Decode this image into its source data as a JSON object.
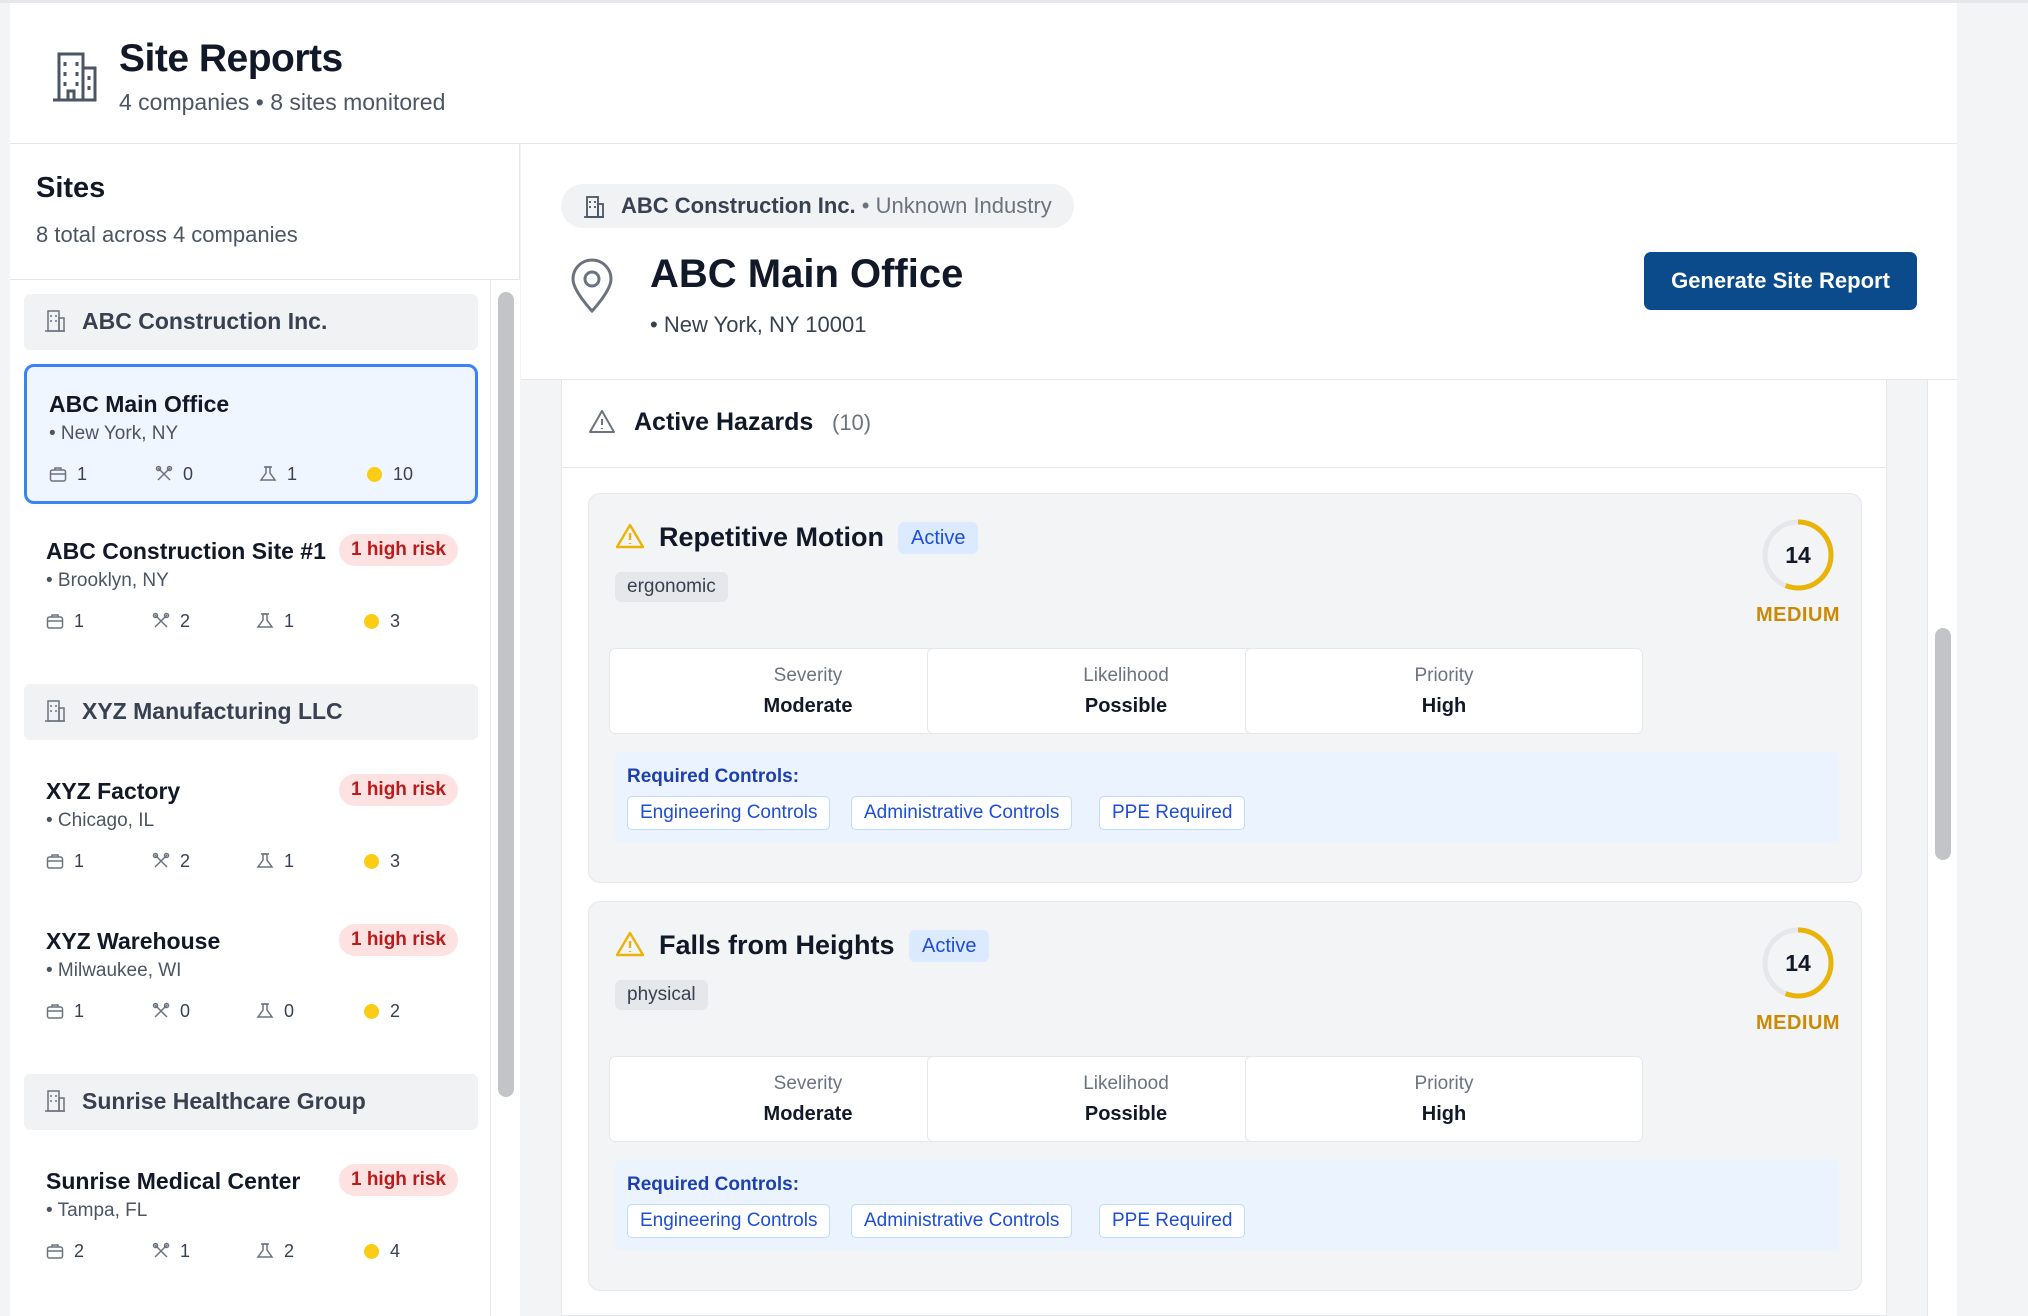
{
  "header": {
    "title": "Site Reports",
    "subtitle": "4 companies • 8 sites monitored",
    "icon": "building-icon"
  },
  "sidebar": {
    "title": "Sites",
    "subtitle": "8 total across 4 companies",
    "groups": [
      {
        "name": "ABC Construction Inc.",
        "sites": [
          {
            "name": "ABC Main Office",
            "location": "• New York, NY",
            "risk": "",
            "stats": {
              "a": "1",
              "b": "0",
              "c": "1",
              "d": "10"
            },
            "selected": true
          },
          {
            "name": "ABC Construction Site #1",
            "location": "• Brooklyn, NY",
            "risk": "1 high risk",
            "stats": {
              "a": "1",
              "b": "2",
              "c": "1",
              "d": "3"
            }
          }
        ]
      },
      {
        "name": "XYZ Manufacturing LLC",
        "sites": [
          {
            "name": "XYZ Factory",
            "location": "• Chicago, IL",
            "risk": "1 high risk",
            "stats": {
              "a": "1",
              "b": "2",
              "c": "1",
              "d": "3"
            }
          },
          {
            "name": "XYZ Warehouse",
            "location": "• Milwaukee, WI",
            "risk": "1 high risk",
            "stats": {
              "a": "1",
              "b": "0",
              "c": "0",
              "d": "2"
            }
          }
        ]
      },
      {
        "name": "Sunrise Healthcare Group",
        "sites": [
          {
            "name": "Sunrise Medical Center",
            "location": "• Tampa, FL",
            "risk": "1 high risk",
            "stats": {
              "a": "2",
              "b": "1",
              "c": "2",
              "d": "4"
            }
          }
        ]
      }
    ]
  },
  "main": {
    "company": "ABC Construction Inc.",
    "industry": "• Unknown Industry",
    "site_title": "ABC Main Office",
    "site_address": "• New York, NY 10001",
    "generate_button": "Generate Site Report",
    "hazards_title": "Active Hazards",
    "hazards_count": "(10)",
    "hazards": [
      {
        "title": "Repetitive Motion",
        "status": "Active",
        "category": "ergonomic",
        "score": "14",
        "score_fraction": 0.56,
        "level": "MEDIUM",
        "metrics": [
          {
            "label": "Severity",
            "value": "Moderate"
          },
          {
            "label": "Likelihood",
            "value": "Possible"
          },
          {
            "label": "Priority",
            "value": "High"
          }
        ],
        "controls_label": "Required Controls:",
        "controls": [
          "Engineering Controls",
          "Administrative Controls",
          "PPE Required"
        ]
      },
      {
        "title": "Falls from Heights",
        "status": "Active",
        "category": "physical",
        "score": "14",
        "score_fraction": 0.56,
        "level": "MEDIUM",
        "metrics": [
          {
            "label": "Severity",
            "value": "Moderate"
          },
          {
            "label": "Likelihood",
            "value": "Possible"
          },
          {
            "label": "Priority",
            "value": "High"
          }
        ],
        "controls_label": "Required Controls:",
        "controls": [
          "Engineering Controls",
          "Administrative Controls",
          "PPE Required"
        ]
      }
    ]
  },
  "colors": {
    "primary": "#0b4a8b",
    "selected_border": "#3b82f6",
    "risk_bg": "#fee2e2",
    "risk_text": "#b91c1c",
    "medium": "#eab308",
    "hazard_dot": "#facc15"
  }
}
